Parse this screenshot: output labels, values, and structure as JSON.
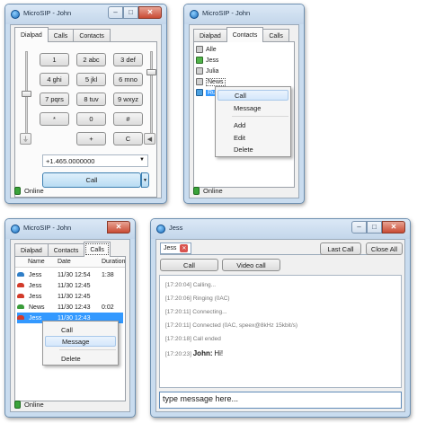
{
  "app": {
    "name": "MicroSIP",
    "title_dialpad": "MicroSIP - John",
    "title_contacts": "MicroSIP - John",
    "title_calls": "MicroSIP - John"
  },
  "tabs": {
    "dialpad": "Dialpad",
    "calls": "Calls",
    "contacts": "Contacts"
  },
  "dialpad": {
    "keys": [
      {
        "label": "1",
        "sub": ""
      },
      {
        "label": "2",
        "sub": "abc"
      },
      {
        "label": "3",
        "sub": "def"
      },
      {
        "label": "4",
        "sub": "ghi"
      },
      {
        "label": "5",
        "sub": "jkl"
      },
      {
        "label": "6",
        "sub": "mno"
      },
      {
        "label": "7",
        "sub": "pqrs"
      },
      {
        "label": "8",
        "sub": "tuv"
      },
      {
        "label": "9",
        "sub": "wxyz"
      },
      {
        "label": "*",
        "sub": ""
      },
      {
        "label": "0",
        "sub": ""
      },
      {
        "label": "#",
        "sub": ""
      }
    ],
    "bottom_keys": [
      "+",
      "C"
    ],
    "number_value": "+1.465.0000000",
    "call_label": "Call"
  },
  "status": {
    "online": "Online"
  },
  "contacts": {
    "items": [
      {
        "name": "Alle",
        "status": "gray"
      },
      {
        "name": "Jess",
        "status": "green"
      },
      {
        "name": "Julia",
        "status": "gray"
      },
      {
        "name": "News",
        "status": "gray"
      },
      {
        "name": "Ruff",
        "status": "blue",
        "selected": true
      }
    ],
    "menu": [
      "Call",
      "Message",
      "Add",
      "Edit",
      "Delete"
    ]
  },
  "calls": {
    "headers": [
      "Name",
      "Date",
      "Duration"
    ],
    "rows": [
      {
        "name": "Jess",
        "date": "11/30 12:54",
        "duration": "1:38",
        "kind": "incoming"
      },
      {
        "name": "Jess",
        "date": "11/30 12:45",
        "duration": "",
        "kind": "missed"
      },
      {
        "name": "Jess",
        "date": "11/30 12:45",
        "duration": "",
        "kind": "missed"
      },
      {
        "name": "News",
        "date": "11/30 12:43",
        "duration": "0:02",
        "kind": "outgoing"
      },
      {
        "name": "Jess",
        "date": "11/30 12:43",
        "duration": "",
        "kind": "missed",
        "selected": true
      }
    ],
    "menu": [
      "Call",
      "Message",
      "Delete"
    ]
  },
  "chat": {
    "title": "Jess",
    "tab_label": "Jess",
    "last_call": "Last Call",
    "close_all": "Close All",
    "call": "Call",
    "video_call": "Video call",
    "log": [
      {
        "time": "[17:20:04]",
        "text": "Calling..."
      },
      {
        "time": "[17:20:06]",
        "text": "Ringing (0AC)"
      },
      {
        "time": "[17:20:11]",
        "text": "Connecting..."
      },
      {
        "time": "[17:20:11]",
        "text": "Connected (0AC, speex@8kHz 15kbit/s)"
      },
      {
        "time": "[17:20:18]",
        "text": "Call ended"
      }
    ],
    "message": {
      "time": "[17:20:23]",
      "sender": "John:",
      "text": "Hi!"
    },
    "input_value": "type message here..."
  },
  "colors": {
    "selection": "#3399ff",
    "online": "#3aa33a",
    "close_button": "#c94b34"
  }
}
